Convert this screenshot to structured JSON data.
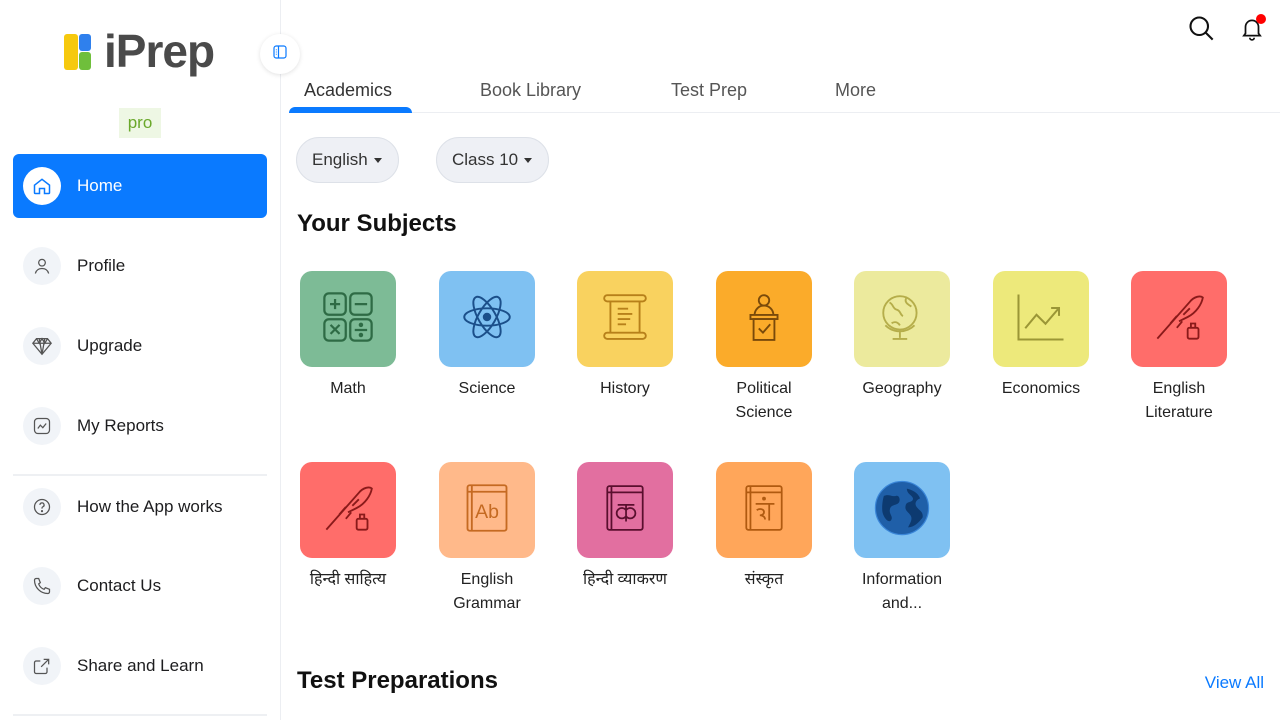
{
  "brand": {
    "name": "iPrep",
    "badge": "pro"
  },
  "sidebar": {
    "items": [
      {
        "label": "Home",
        "icon": "home-icon",
        "active": true
      },
      {
        "label": "Profile",
        "icon": "user-icon"
      },
      {
        "label": "Upgrade",
        "icon": "diamond-icon"
      },
      {
        "label": "My Reports",
        "icon": "chart-icon"
      },
      {
        "label": "How the App works",
        "icon": "help-icon"
      },
      {
        "label": "Contact Us",
        "icon": "phone-icon"
      },
      {
        "label": "Share and Learn",
        "icon": "share-icon"
      }
    ]
  },
  "tabs": [
    {
      "label": "Academics",
      "active": true
    },
    {
      "label": "Book Library"
    },
    {
      "label": "Test Prep"
    },
    {
      "label": "More"
    }
  ],
  "filters": {
    "language": "English",
    "class": "Class 10"
  },
  "sections": {
    "subjects_title": "Your Subjects",
    "tests_title": "Test Preparations",
    "view_all": "View All"
  },
  "subjects": [
    {
      "line1": "Math",
      "line2": "",
      "color": "#7dbb96",
      "icon": "math-icon"
    },
    {
      "line1": "Science",
      "line2": "",
      "color": "#7fc1f2",
      "icon": "atom-icon"
    },
    {
      "line1": "History",
      "line2": "",
      "color": "#f9d25f",
      "icon": "scroll-icon"
    },
    {
      "line1": "Political",
      "line2": "Science",
      "color": "#fbab2a",
      "icon": "podium-icon"
    },
    {
      "line1": "Geography",
      "line2": "",
      "color": "#ecea9d",
      "icon": "globe-icon"
    },
    {
      "line1": "Economics",
      "line2": "",
      "color": "#ede97b",
      "icon": "trend-icon"
    },
    {
      "line1": "English",
      "line2": "Literature",
      "color": "#ff6d6a",
      "icon": "quill-icon"
    },
    {
      "line1": "हिन्दी साहित्य",
      "line2": "",
      "color": "#ff6d6a",
      "icon": "quill-icon"
    },
    {
      "line1": "English",
      "line2": "Grammar",
      "color": "#ffb98a",
      "icon": "book-ab-icon"
    },
    {
      "line1": "हिन्दी व्याकरण",
      "line2": "",
      "color": "#e26fa0",
      "icon": "book-ka-icon"
    },
    {
      "line1": "संस्कृत",
      "line2": "",
      "color": "#ffa65a",
      "icon": "book-sam-icon"
    },
    {
      "line1": "Information",
      "line2": "and...",
      "color": "#7fc1f2",
      "icon": "earth-icon"
    }
  ]
}
